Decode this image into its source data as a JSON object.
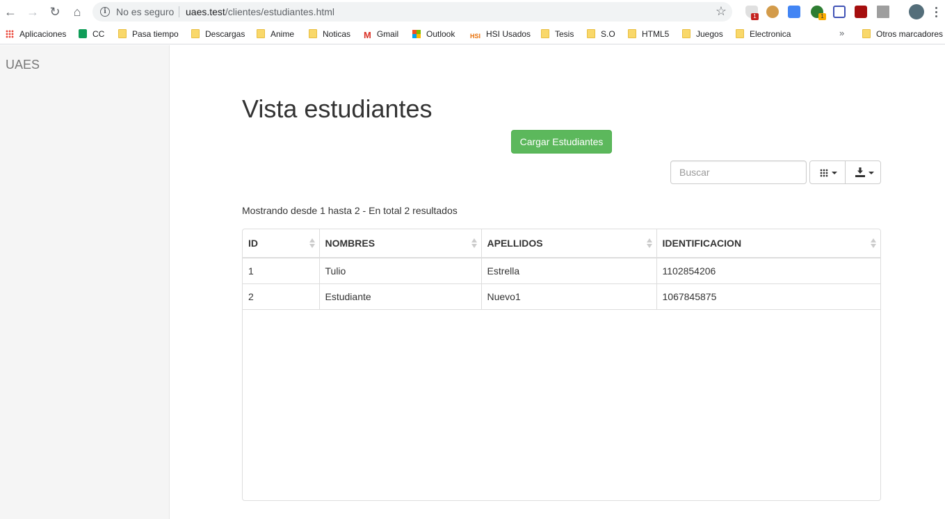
{
  "browser": {
    "security_text": "No es seguro",
    "url_host": "uaes.test",
    "url_path": "/clientes/estudiantes.html",
    "bookmarks": [
      {
        "label": "Aplicaciones",
        "icon": "apps-icon"
      },
      {
        "label": "CC",
        "icon": "sheets-icon"
      },
      {
        "label": "Pasa tiempo",
        "icon": "folder-icon"
      },
      {
        "label": "Descargas",
        "icon": "folder-icon"
      },
      {
        "label": "Anime",
        "icon": "folder-icon"
      },
      {
        "label": "Noticas",
        "icon": "folder-icon"
      },
      {
        "label": "Gmail",
        "icon": "gmail-icon"
      },
      {
        "label": "Outlook",
        "icon": "microsoft-icon"
      },
      {
        "label": "HSI Usados",
        "icon": "hsi-icon"
      },
      {
        "label": "Tesis",
        "icon": "folder-icon"
      },
      {
        "label": "S.O",
        "icon": "folder-icon"
      },
      {
        "label": "HTML5",
        "icon": "folder-icon"
      },
      {
        "label": "Juegos",
        "icon": "folder-icon"
      },
      {
        "label": "Electronica",
        "icon": "folder-icon"
      }
    ],
    "more_bookmarks": "»",
    "other_bookmarks": "Otros marcadores",
    "extension_badges": [
      "1",
      "1"
    ]
  },
  "sidebar": {
    "brand": "UAES"
  },
  "main": {
    "title": "Vista estudiantes",
    "load_button": "Cargar Estudiantes",
    "search_placeholder": "Buscar",
    "result_info": "Mostrando desde 1 hasta 2 - En total 2 resultados"
  },
  "table": {
    "columns": [
      "ID",
      "NOMBRES",
      "APELLIDOS",
      "IDENTIFICACION"
    ],
    "rows": [
      [
        "1",
        "Tulio",
        "Estrella",
        "1102854206"
      ],
      [
        "2",
        "Estudiante",
        "Nuevo1",
        "1067845875"
      ]
    ]
  },
  "colors": {
    "success_button": "#5cb85c",
    "sidebar_bg": "#f5f5f5"
  }
}
